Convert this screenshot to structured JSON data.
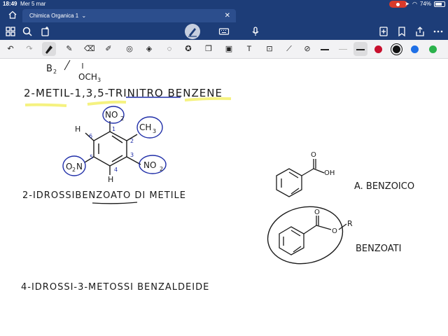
{
  "status": {
    "time": "18:49",
    "date": "Mer 5 mar",
    "battery": "74%"
  },
  "tab": {
    "title": "Chimica Organica 1",
    "dropdown": "⌄",
    "close": "✕"
  },
  "notes": {
    "line0_a": "B",
    "line0_b": "2",
    "line0_c": "OCH",
    "line0_d": "3",
    "title1": "2-METIL-1,3,5-TRINITRO BENZENE",
    "no2_top": "NO",
    "no2_top_sub": "2",
    "ch3": "CH",
    "ch3_sub": "3",
    "h_left": "H",
    "h_bottom": "H",
    "o2n_left": "O",
    "o2n_left_sub": "2",
    "o2n_left_n": "N",
    "no2_right": "NO",
    "no2_right_sub": "2",
    "num1": "1",
    "num2": "2",
    "num3": "3",
    "num4": "4",
    "num5": "5",
    "num6": "6",
    "title2": "2-IDROSSIBENZOATO DI METILE",
    "benzoic_label": "A. BENZOICO",
    "benzoic_oh": "OH",
    "benzoic_o": "O",
    "benzoati_label": "BENZOATI",
    "benzoati_r": "R",
    "benzoati_o1": "O",
    "benzoati_o2": "O",
    "title3": "4-IDROSSI-3-METOSSI BENZALDEIDE"
  },
  "colors": {
    "appbar": "#1d3d78",
    "tab": "#2c4e8d",
    "toolbar2": "#f2f2f4",
    "red": "#c8102e",
    "black": "#111111",
    "blue": "#1e6fe6",
    "green": "#2bb24c",
    "highlighter": "#f3f06a"
  }
}
